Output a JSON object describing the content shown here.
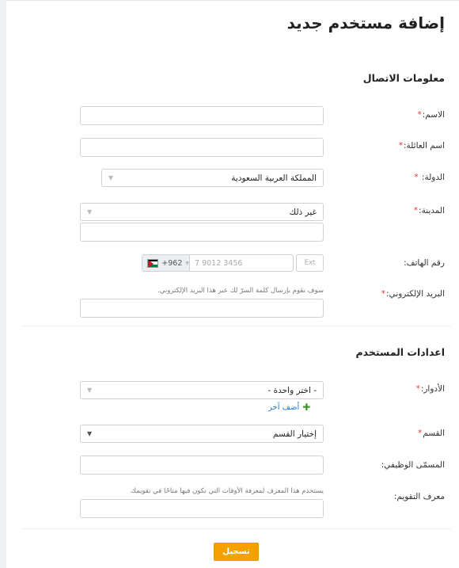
{
  "page_title": "إضافة مستخدم جديد",
  "contact_section": {
    "title": "معلومات الاتصال",
    "first_name_label": "الاسم:",
    "last_name_label": "اسم العائلة:",
    "country_label": "الدولة:",
    "country_value": "المملكة العربية السعودية",
    "city_label": "المدينة:",
    "city_value": "غير ذلك",
    "phone_label": "رقم الهاتف:",
    "phone_code": "+962",
    "phone_placeholder": "7 9012 3456",
    "ext_placeholder": "Ext",
    "email_hint": "سوف نقوم بإرسال كلمة السرّ لك عبر هذا البريد الإلكتروني.",
    "email_label": "البريد الإلكتروني:"
  },
  "user_section": {
    "title": "اعدادات المستخدم",
    "roles_label": "الأدوار:",
    "roles_value": "- اختر واحدة -",
    "add_another": "أضف آخر",
    "department_label": "القسم",
    "department_value": "إختيار القسم",
    "job_title_label": "المسمّى الوظيفي:",
    "calendar_hint": "يستخدم هذا المعرف لمعرفة الأوقات التي تكون فيها متاحًا في تقويمك",
    "calendar_label": "معرف التقويم:"
  },
  "required_marker": "*",
  "submit_label": "تسجيل",
  "colors": {
    "accent": "#f5a200",
    "required": "#e43c3c",
    "link": "#2e7bc6"
  },
  "icons": {
    "select_caret": "triangle-down",
    "add": "plus",
    "flag": "jordan-flag"
  }
}
